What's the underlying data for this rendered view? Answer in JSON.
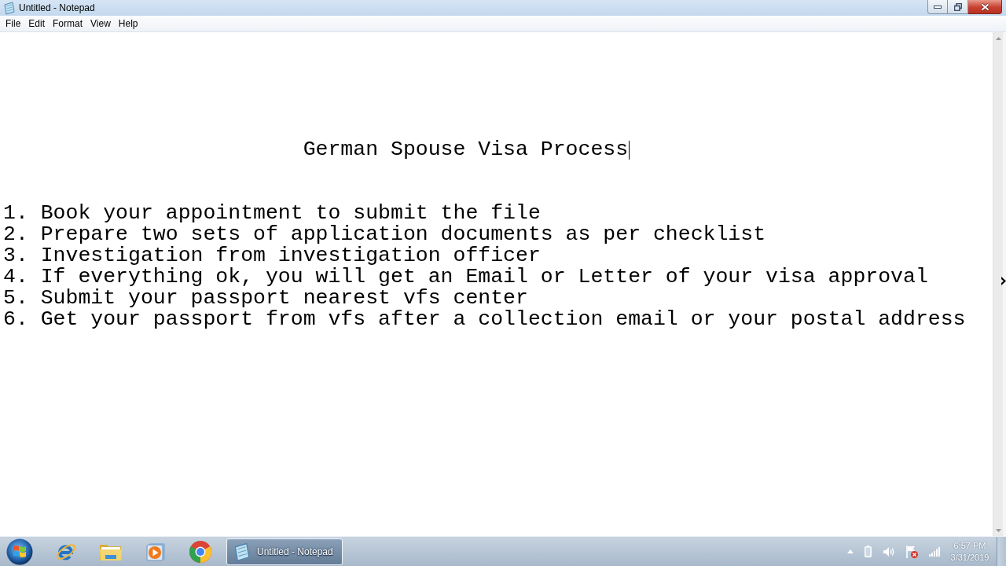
{
  "window": {
    "title": "Untitled - Notepad"
  },
  "menu": [
    "File",
    "Edit",
    "Format",
    "View",
    "Help"
  ],
  "document": {
    "heading": {
      "text": "German Spouse Visa Process",
      "caret": true
    },
    "lines": [
      "1. Book your appointment to submit the file",
      "2. Prepare two sets of application documents as per checklist",
      "3. Investigation from investigation officer",
      "4. If everything ok, you will get an Email or Letter of your visa approval",
      "5. Submit your passport nearest vfs center",
      "6. Get your passport from vfs after a collection email or your postal address"
    ]
  },
  "taskbar": {
    "tasks": [
      {
        "label": "Untitled - Notepad",
        "selected": true
      }
    ],
    "clock": {
      "time": "6:57 PM",
      "date": "3/31/2019"
    }
  }
}
